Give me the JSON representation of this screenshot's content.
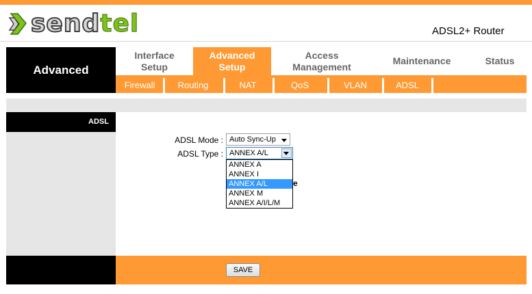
{
  "brand": {
    "logo_text_part1": "send",
    "logo_text_part2": "tel",
    "product": "ADSL2+ Router"
  },
  "section": {
    "title": "Advanced"
  },
  "tabs": [
    {
      "line1": "Interface",
      "line2": "Setup"
    },
    {
      "line1": "Advanced",
      "line2": "Setup"
    },
    {
      "line1": "Access",
      "line2": "Management"
    },
    {
      "line1": "Maintenance"
    },
    {
      "line1": "Status"
    }
  ],
  "subnav": [
    "Firewall",
    "Routing",
    "NAT",
    "QoS",
    "VLAN",
    "ADSL"
  ],
  "sidebar": {
    "label": "ADSL"
  },
  "form": {
    "mode_label": "ADSL Mode :",
    "mode_value": "Auto Sync-Up",
    "type_label": "ADSL Type :",
    "type_value": "ANNEX A/L",
    "type_options": [
      "ANNEX A",
      "ANNEX I",
      "ANNEX A/L",
      "ANNEX M",
      "ANNEX A/I/L/M"
    ],
    "partial_text": "e"
  },
  "footer": {
    "save_label": "SAVE"
  },
  "colors": {
    "accent": "#ff9933",
    "logo_green": "#7cc31a",
    "selection": "#3399ff"
  }
}
